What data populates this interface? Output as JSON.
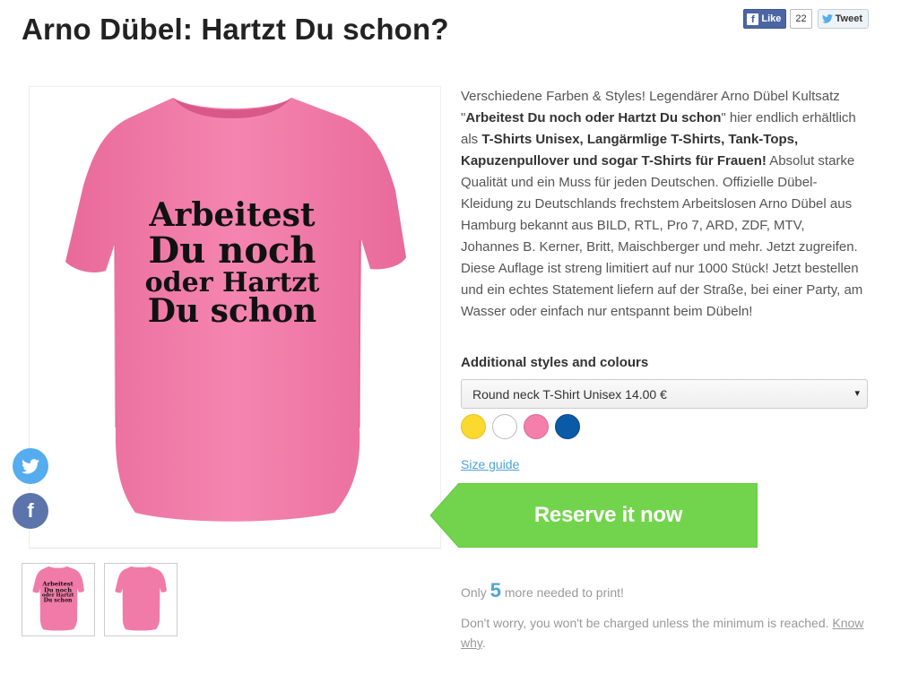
{
  "page": {
    "title": "Arno Dübel: Hartzt Du schon?"
  },
  "social_top": {
    "fb_like_label": "Like",
    "fb_count": "22",
    "tweet_label": "Tweet"
  },
  "product_image": {
    "shirt_text_line1": "Arbeitest",
    "shirt_text_line2": "Du noch",
    "shirt_text_line3": "oder Hartzt",
    "shirt_text_line4": "Du schon",
    "shirt_color": "#f47fab"
  },
  "float_social": {
    "twitter_icon": "twitter-icon",
    "facebook_icon": "facebook-icon",
    "facebook_glyph": "f"
  },
  "description": {
    "p1": "Verschiedene Farben & Styles! Legendärer Arno Dübel Kultsatz \"",
    "b1": "Arbeitest Du noch oder Hartzt Du schon",
    "p2": "\" hier endlich erhältlich als ",
    "b2": "T-Shirts Unisex, Langärmlige T-Shirts, Tank-Tops, Kapuzenpullover und sogar T-Shirts für Frauen!",
    "p3": " Absolut starke Qualität und ein Muss für jeden Deutschen. Offizielle Dübel-Kleidung zu Deutschlands frechstem Arbeitslosen Arno Dübel aus Hamburg bekannt aus BILD, RTL, Pro 7, ARD, ZDF, MTV, Johannes B. Kerner, Britt, Maischberger und mehr. Jetzt zugreifen. Diese Auflage ist streng limitiert auf nur 1000 Stück! Jetzt bestellen und ein echtes Statement liefern auf der Straße, bei einer Party, am Wasser oder einfach nur entspannt beim Dübeln!"
  },
  "styles": {
    "label": "Additional styles and colours",
    "selected_option": "Round neck T-Shirt Unisex 14.00 €",
    "caret": "▾",
    "swatches": [
      "#fcd92f",
      "#ffffff",
      "#f47fab",
      "#0b5aa8"
    ]
  },
  "size_guide": "Size guide",
  "reserve_button": {
    "label": "Reserve it now",
    "color": "#72d44c"
  },
  "campaign": {
    "only_prefix": "Only",
    "only_number": "5",
    "only_suffix": "more needed to print!",
    "worry_text": "Don't worry, you won't be charged unless the minimum is reached.",
    "know_why": "Know why",
    "period": "."
  },
  "accent_color": "#4da3d9"
}
